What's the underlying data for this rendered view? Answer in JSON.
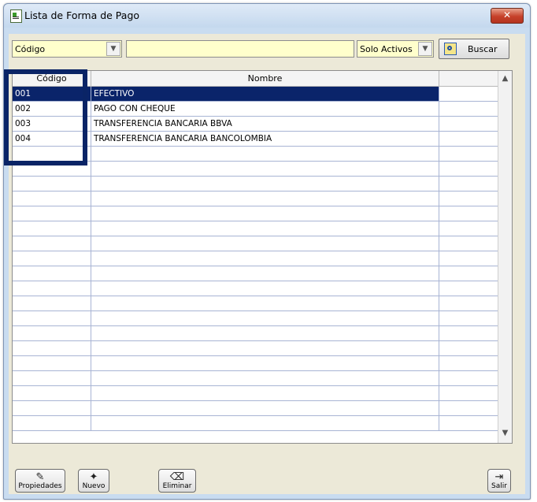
{
  "window": {
    "title": "Lista de Forma de Pago",
    "close_label": "✕"
  },
  "filter": {
    "field_value": "Código",
    "search_value": "",
    "status_value": "Solo Activos",
    "search_button": "Buscar"
  },
  "grid": {
    "columns": [
      "Código",
      "Nombre"
    ],
    "rows": [
      {
        "code": "001",
        "name": "EFECTIVO",
        "selected": true
      },
      {
        "code": "002",
        "name": "PAGO CON CHEQUE"
      },
      {
        "code": "003",
        "name": "TRANSFERENCIA BANCARIA BBVA"
      },
      {
        "code": "004",
        "name": "TRANSFERENCIA BANCARIA BANCOLOMBIA"
      }
    ]
  },
  "toolbar": {
    "properties_label": "Propiedades",
    "new_label": "Nuevo",
    "delete_label": "Eliminar",
    "exit_label": "Salir"
  },
  "icons": {
    "app": "form-icon",
    "properties": "properties-icon",
    "new": "new-document-icon",
    "delete": "eraser-icon",
    "exit": "exit-door-icon",
    "search": "search-icon"
  },
  "colors": {
    "selection": "#0a246a",
    "input_background": "#ffffcc",
    "close_button": "#c6412a"
  }
}
